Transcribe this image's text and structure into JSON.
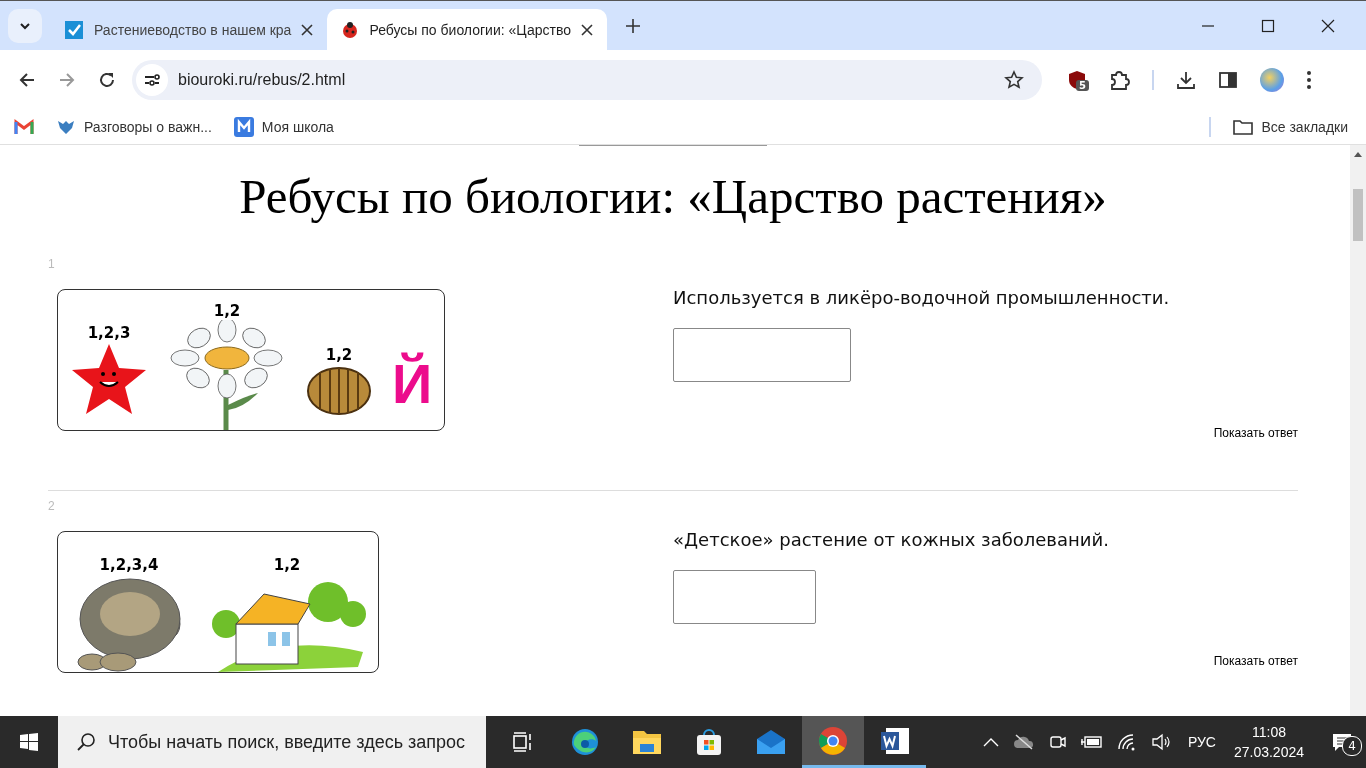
{
  "browser": {
    "tabs": [
      {
        "title": "Растениеводство в нашем кра",
        "selected": false
      },
      {
        "title": "Ребусы по биологии: «Царство",
        "selected": true
      }
    ],
    "address": "biouroki.ru/rebus/2.html",
    "extension_badge": "5",
    "bookmarks": [
      {
        "label": "Разговоры о важн..."
      },
      {
        "label": "Моя школа"
      }
    ],
    "all_bookmarks": "Все закладки"
  },
  "page": {
    "title": "Ребусы по биологии: «Царство растения»",
    "items": [
      {
        "number": "1",
        "question": "Используется в ликёро-водочной промышленности.",
        "show_answer": "Показать ответ",
        "rebus": [
          {
            "kind": "star",
            "label": "1,2,3"
          },
          {
            "kind": "flower",
            "label": "1,2"
          },
          {
            "kind": "basket",
            "label": "1,2"
          },
          {
            "kind": "letter",
            "label": "Й"
          }
        ]
      },
      {
        "number": "2",
        "question": "«Детское» растение от кожных заболеваний.",
        "show_answer": "Показать ответ",
        "rebus": [
          {
            "kind": "turtle",
            "label": "1,2,3,4"
          },
          {
            "kind": "house",
            "label": "1,2"
          }
        ]
      }
    ]
  },
  "taskbar": {
    "search_placeholder": "Чтобы начать поиск, введите здесь запрос",
    "apps": [
      {
        "kind": "taskview",
        "running": false,
        "selected": false
      },
      {
        "kind": "edge",
        "running": false,
        "selected": false
      },
      {
        "kind": "explorer",
        "running": false,
        "selected": false
      },
      {
        "kind": "store",
        "running": false,
        "selected": false
      },
      {
        "kind": "mail",
        "running": false,
        "selected": false
      },
      {
        "kind": "chrome",
        "running": true,
        "selected": true
      },
      {
        "kind": "word",
        "running": true,
        "selected": false
      }
    ],
    "language": "РУС",
    "time": "11:08",
    "date": "27.03.2024",
    "notifications": "4"
  }
}
